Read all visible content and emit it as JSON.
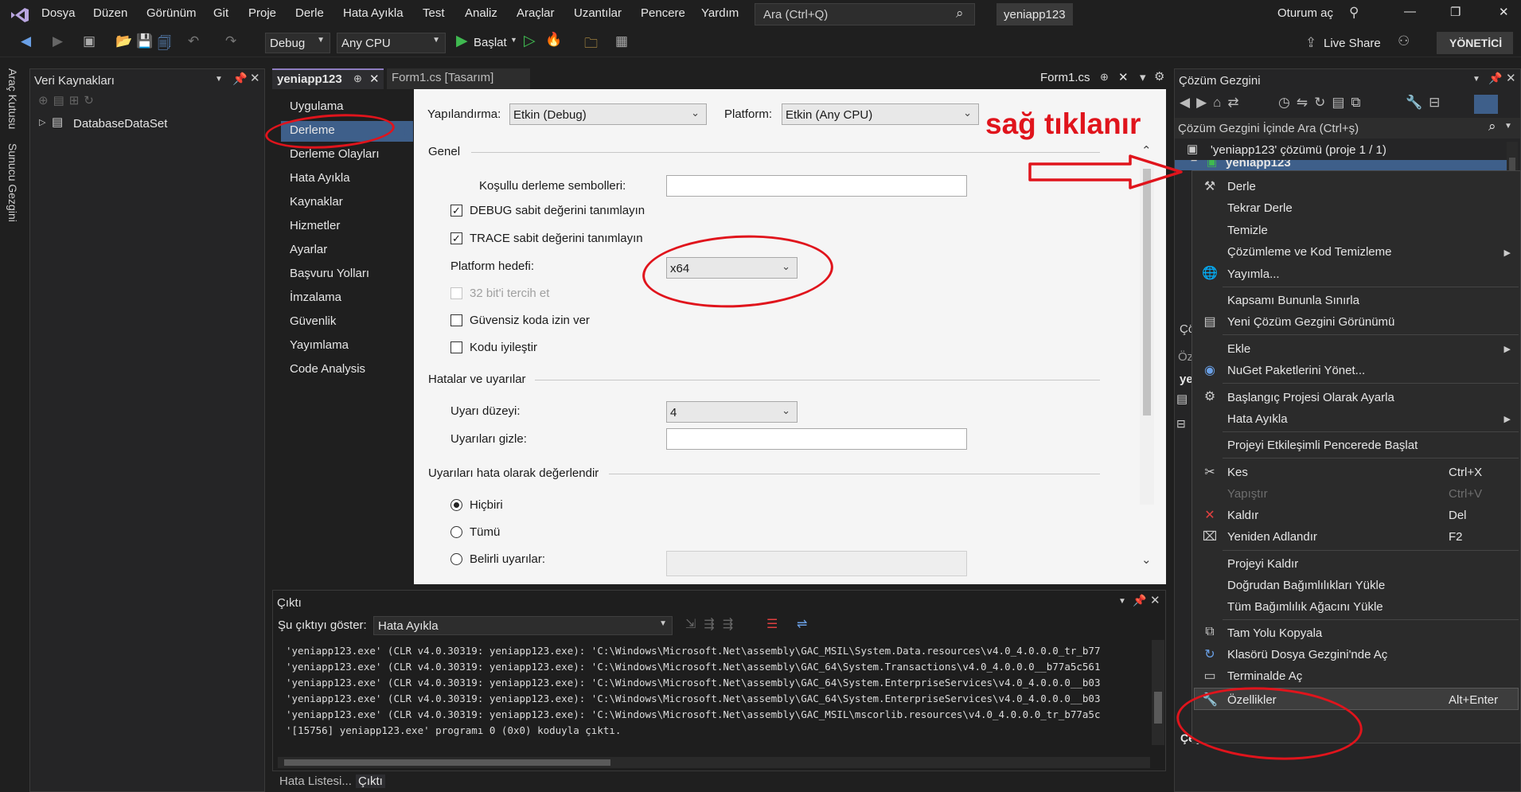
{
  "menubar": {
    "items": [
      "Dosya",
      "Düzen",
      "Görünüm",
      "Git",
      "Proje",
      "Derle",
      "Hata Ayıkla",
      "Test",
      "Analiz",
      "Araçlar",
      "Uzantılar",
      "Pencere",
      "Yardım"
    ],
    "search_text": "Ara (Ctrl+Q)",
    "project_name": "yeniapp123",
    "signin": "Oturum aç",
    "window_controls": [
      "—",
      "❐",
      "✕"
    ]
  },
  "toolbar": {
    "config": "Debug",
    "platform": "Any CPU",
    "start": "Başlat",
    "live_share": "Live Share",
    "admin": "YÖNETİCİ"
  },
  "left_strip": {
    "toolbox": "Araç Kutusu",
    "server_explorer": "Sunucu Gezgini"
  },
  "data_sources": {
    "title": "Veri Kaynakları",
    "item": "DatabaseDataSet"
  },
  "tabs": {
    "active": "yeniapp123",
    "pin_mark": "⊕",
    "designer": "Form1.cs [Tasarım]",
    "form_cs": "Form1.cs"
  },
  "prop_nav": {
    "items": [
      "Uygulama",
      "Derleme",
      "Derleme Olayları",
      "Hata Ayıkla",
      "Kaynaklar",
      "Hizmetler",
      "Ayarlar",
      "Başvuru Yolları",
      "İmzalama",
      "Güvenlik",
      "Yayımlama",
      "Code Analysis"
    ]
  },
  "build_page": {
    "config_label": "Yapılandırma:",
    "config_value": "Etkin (Debug)",
    "platform_label": "Platform:",
    "platform_value": "Etkin (Any CPU)",
    "general": "Genel",
    "cond_symbols": "Koşullu derleme sembolleri:",
    "debug_const": "DEBUG sabit değerini tanımlayın",
    "trace_const": "TRACE sabit değerini tanımlayın",
    "platform_target": "Platform hedefi:",
    "platform_target_value": "x64",
    "prefer32": "32 bit'i tercih et",
    "unsafe": "Güvensiz koda izin ver",
    "optimize": "Kodu iyileştir",
    "errors_section": "Hatalar ve uyarılar",
    "warning_level": "Uyarı düzeyi:",
    "warning_level_value": "4",
    "suppress": "Uyarıları gizle:",
    "treat_section": "Uyarıları hata olarak değerlendir",
    "none": "Hiçbiri",
    "all": "Tümü",
    "specific": "Belirli uyarılar:",
    "checks": {
      "debug": "✓",
      "trace": "✓"
    }
  },
  "output": {
    "title": "Çıktı",
    "show_label": "Şu çıktıyı göster:",
    "show_value": "Hata Ayıkla",
    "lines": [
      "'yeniapp123.exe' (CLR v4.0.30319: yeniapp123.exe): 'C:\\Windows\\Microsoft.Net\\assembly\\GAC_MSIL\\System.Data.resources\\v4.0_4.0.0.0_tr_b77",
      "'yeniapp123.exe' (CLR v4.0.30319: yeniapp123.exe): 'C:\\Windows\\Microsoft.Net\\assembly\\GAC_64\\System.Transactions\\v4.0_4.0.0.0__b77a5c561",
      "'yeniapp123.exe' (CLR v4.0.30319: yeniapp123.exe): 'C:\\Windows\\Microsoft.Net\\assembly\\GAC_64\\System.EnterpriseServices\\v4.0_4.0.0.0__b03",
      "'yeniapp123.exe' (CLR v4.0.30319: yeniapp123.exe): 'C:\\Windows\\Microsoft.Net\\assembly\\GAC_64\\System.EnterpriseServices\\v4.0_4.0.0.0__b03",
      "'yeniapp123.exe' (CLR v4.0.30319: yeniapp123.exe): 'C:\\Windows\\Microsoft.Net\\assembly\\GAC_MSIL\\mscorlib.resources\\v4.0_4.0.0.0_tr_b77a5c",
      "'[15756] yeniapp123.exe' programı 0 (0x0) koduyla çıktı."
    ]
  },
  "bottom_tabs": [
    "Hata Listesi...",
    "Çıktı"
  ],
  "solution_explorer": {
    "title": "Çözüm Gezgini",
    "search": "Çözüm Gezgini İçinde Ara (Ctrl+ş)",
    "solution": "'yeniapp123' çözümü (proje 1 / 1)",
    "project": "yeniapp123",
    "peek": [
      "Çö",
      "Öz",
      "ye"
    ],
    "misc": "Çeşitli"
  },
  "context_menu": {
    "build": "Derle",
    "rebuild": "Tekrar Derle",
    "clean": "Temizle",
    "analyze": "Çözümleme ve Kod Temizleme",
    "publish": "Yayımla...",
    "scope": "Kapsamı Bununla Sınırla",
    "new_view": "Yeni Çözüm Gezgini Görünümü",
    "add": "Ekle",
    "nuget": "NuGet Paketlerini Yönet...",
    "startup": "Başlangıç Projesi Olarak Ayarla",
    "debug": "Hata Ayıkla",
    "interactive": "Projeyi Etkileşimli Pencerede Başlat",
    "cut": "Kes",
    "cut_sc": "Ctrl+X",
    "paste": "Yapıştır",
    "paste_sc": "Ctrl+V",
    "remove": "Kaldır",
    "remove_sc": "Del",
    "rename": "Yeniden Adlandır",
    "rename_sc": "F2",
    "unload": "Projeyi Kaldır",
    "load_direct": "Doğrudan Bağımlılıkları Yükle",
    "load_tree": "Tüm Bağımlılık Ağacını Yükle",
    "copy_path": "Tam Yolu Kopyala",
    "open_folder": "Klasörü Dosya Gezgini'nde Aç",
    "terminal": "Terminalde Aç",
    "properties": "Özellikler",
    "properties_sc": "Alt+Enter"
  },
  "annotation": {
    "text": "sağ tıklanır",
    "color": "#e0141c"
  },
  "colors": {
    "accent": "#3e5f8a",
    "annotation_red": "#e0141c",
    "run_green": "#3fb950"
  }
}
